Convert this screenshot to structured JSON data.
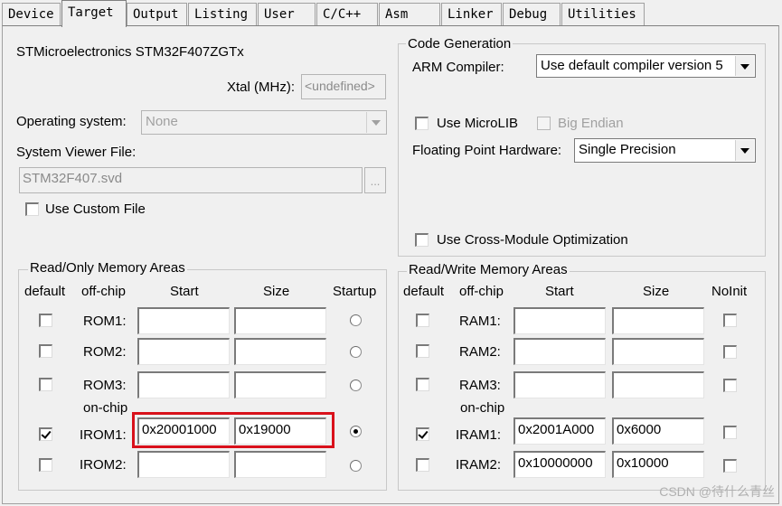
{
  "tabs": [
    {
      "label": "Device"
    },
    {
      "label": "Target"
    },
    {
      "label": "Output"
    },
    {
      "label": "Listing"
    },
    {
      "label": "User"
    },
    {
      "label": "C/C++"
    },
    {
      "label": "Asm"
    },
    {
      "label": "Linker"
    },
    {
      "label": "Debug"
    },
    {
      "label": "Utilities"
    }
  ],
  "active_tab": "Target",
  "device": {
    "name": "STMicroelectronics STM32F407ZGTx",
    "xtal_label": "Xtal (MHz):",
    "xtal_value": "<undefined>",
    "os_label": "Operating system:",
    "os_value": "None",
    "svd_label": "System Viewer File:",
    "svd_value": "STM32F407.svd",
    "browse_label": "...",
    "custom_file_label": "Use Custom File"
  },
  "code_gen": {
    "legend": "Code Generation",
    "compiler_label": "ARM Compiler:",
    "compiler_value": "Use default compiler version 5",
    "microlib_label": "Use MicroLIB",
    "microlib_checked": false,
    "bigendian_label": "Big Endian",
    "fpu_label": "Floating Point Hardware:",
    "fpu_value": "Single Precision",
    "cross_module_label": "Use Cross-Module Optimization"
  },
  "ro_memory": {
    "legend": "Read/Only Memory Areas",
    "headers": {
      "default": "default",
      "offchip": "off-chip",
      "start": "Start",
      "size": "Size",
      "startup": "Startup"
    },
    "onchip_label": "on-chip",
    "rows": [
      {
        "name": "ROM1:",
        "default": false,
        "start": "",
        "size": "",
        "startup": false
      },
      {
        "name": "ROM2:",
        "default": false,
        "start": "",
        "size": "",
        "startup": false
      },
      {
        "name": "ROM3:",
        "default": false,
        "start": "",
        "size": "",
        "startup": false
      },
      {
        "name": "IROM1:",
        "default": true,
        "start": "0x20001000",
        "size": "0x19000",
        "startup": true
      },
      {
        "name": "IROM2:",
        "default": false,
        "start": "",
        "size": "",
        "startup": false
      }
    ]
  },
  "rw_memory": {
    "legend": "Read/Write Memory Areas",
    "headers": {
      "default": "default",
      "offchip": "off-chip",
      "start": "Start",
      "size": "Size",
      "noinit": "NoInit"
    },
    "onchip_label": "on-chip",
    "rows": [
      {
        "name": "RAM1:",
        "default": false,
        "start": "",
        "size": "",
        "noinit": false
      },
      {
        "name": "RAM2:",
        "default": false,
        "start": "",
        "size": "",
        "noinit": false
      },
      {
        "name": "RAM3:",
        "default": false,
        "start": "",
        "size": "",
        "noinit": false
      },
      {
        "name": "IRAM1:",
        "default": true,
        "start": "0x2001A000",
        "size": "0x6000",
        "noinit": false
      },
      {
        "name": "IRAM2:",
        "default": false,
        "start": "0x10000000",
        "size": "0x10000",
        "noinit": false
      }
    ]
  },
  "watermark": "CSDN @待什么青丝",
  "highlight_color": "#d9111b"
}
